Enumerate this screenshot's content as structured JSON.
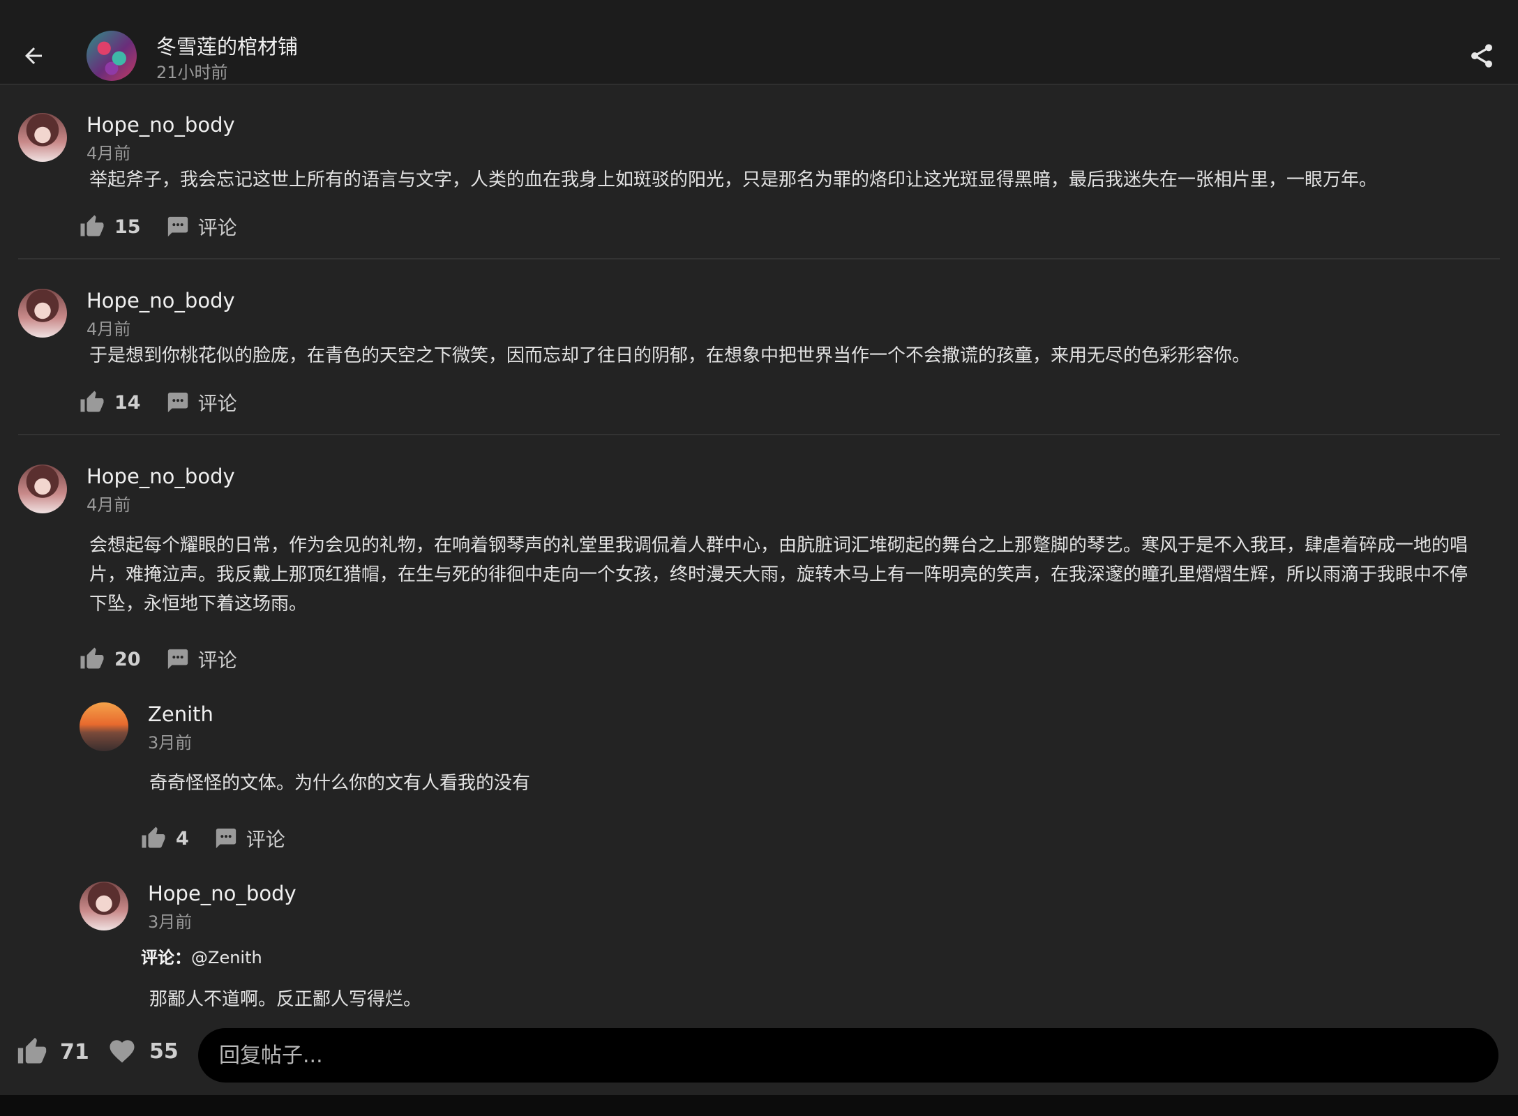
{
  "header": {
    "title": "冬雪莲的棺材铺",
    "time": "21小时前"
  },
  "posts": [
    {
      "username": "Hope_no_body",
      "time": "4月前",
      "content": "举起斧子，我会忘记这世上所有的语言与文字，人类的血在我身上如斑驳的阳光，只是那名为罪的烙印让这光斑显得黑暗，最后我迷失在一张相片里，一眼万年。",
      "likes": "15",
      "comment_label": "评论"
    },
    {
      "username": "Hope_no_body",
      "time": "4月前",
      "content": "于是想到你桃花似的脸庞，在青色的天空之下微笑，因而忘却了往日的阴郁，在想象中把世界当作一个不会撒谎的孩童，来用无尽的色彩形容你。",
      "likes": "14",
      "comment_label": "评论"
    },
    {
      "username": "Hope_no_body",
      "time": "4月前",
      "content": "会想起每个耀眼的日常，作为会见的礼物，在响着钢琴声的礼堂里我调侃着人群中心，由肮脏词汇堆砌起的舞台之上那蹩脚的琴艺。寒风于是不入我耳，肆虐着碎成一地的唱片，难掩泣声。我反戴上那顶红猎帽，在生与死的徘徊中走向一个女孩，终时漫天大雨，旋转木马上有一阵明亮的笑声，在我深邃的瞳孔里熠熠生辉，所以雨滴于我眼中不停下坠，永恒地下着这场雨。",
      "likes": "20",
      "comment_label": "评论"
    }
  ],
  "replies": [
    {
      "username": "Zenith",
      "time": "3月前",
      "content": "奇奇怪怪的文体。为什么你的文有人看我的没有",
      "likes": "4",
      "comment_label": "评论"
    },
    {
      "username": "Hope_no_body",
      "time": "3月前",
      "prefix_label": "评论：",
      "prefix_target": "@Zenith",
      "content": "那鄙人不道啊。反正鄙人写得烂。"
    }
  ],
  "bottom": {
    "likes": "71",
    "favorites": "55",
    "reply_placeholder": "回复帖子..."
  },
  "icons": {
    "back": "arrow-left-icon",
    "share": "share-icon",
    "like": "thumb-up-icon",
    "comment": "comment-bubble-icon",
    "favorite": "heart-icon"
  }
}
